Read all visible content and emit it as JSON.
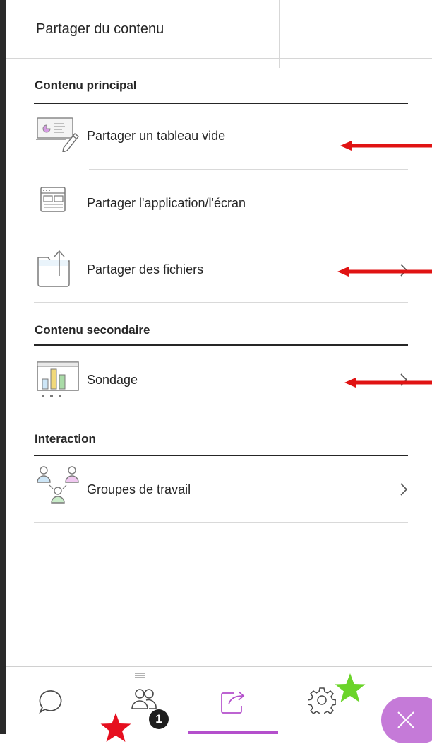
{
  "panel": {
    "title": "Partager du contenu"
  },
  "sections": {
    "primary": {
      "heading": "Contenu principal",
      "items": [
        {
          "label": "Partager un tableau vide",
          "icon": "whiteboard-icon"
        },
        {
          "label": "Partager l'application/l'écran",
          "icon": "app-window-icon"
        },
        {
          "label": "Partager des fichiers",
          "icon": "folder-upload-icon"
        }
      ]
    },
    "secondary": {
      "heading": "Contenu secondaire",
      "items": [
        {
          "label": "Sondage",
          "icon": "poll-chart-icon"
        }
      ]
    },
    "interaction": {
      "heading": "Interaction",
      "items": [
        {
          "label": "Groupes de travail",
          "icon": "breakout-groups-icon"
        }
      ]
    }
  },
  "bottom_bar": {
    "tabs": [
      "chat-icon",
      "participants-icon",
      "share-content-icon",
      "settings-icon",
      "close-icon"
    ],
    "active_tab": "share-content-icon",
    "participants_badge": "1"
  },
  "colors": {
    "accent": "#b44fcc",
    "close_button": "#c57ad8",
    "annotation_arrow": "#e01313",
    "annotation_star_red": "#e60f1f",
    "annotation_star_green": "#6bd42a"
  }
}
